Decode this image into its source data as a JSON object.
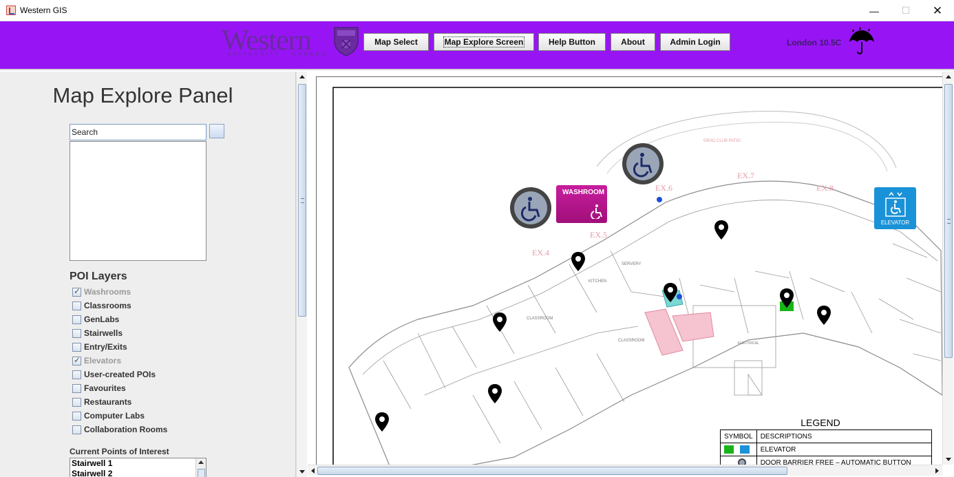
{
  "window": {
    "title": "Western GIS",
    "minimize_glyph": "—",
    "maximize_glyph": "☐",
    "close_glyph": "✕"
  },
  "header": {
    "logo_word": "Western",
    "logo_sub": "UNIVERSITY · CANADA",
    "nav": [
      {
        "label": "Map Select"
      },
      {
        "label": "Map Explore Screen"
      },
      {
        "label": "Help Button"
      },
      {
        "label": "About"
      },
      {
        "label": "Admin Login"
      }
    ],
    "weather_text": "London  10.5C",
    "weather_icon": "umbrella-icon",
    "accent_color": "#9715f4"
  },
  "left_panel": {
    "title": "Map Explore Panel",
    "search_value": "Search",
    "poi_heading": "POI Layers",
    "layers": [
      {
        "label": "Washrooms",
        "checked": true
      },
      {
        "label": "Classrooms",
        "checked": false
      },
      {
        "label": "GenLabs",
        "checked": false
      },
      {
        "label": "Stairwells",
        "checked": false
      },
      {
        "label": "Entry/Exits",
        "checked": false
      },
      {
        "label": "Elevators",
        "checked": true
      },
      {
        "label": "User-created POIs",
        "checked": false
      },
      {
        "label": "Favourites",
        "checked": false
      },
      {
        "label": "Restaurants",
        "checked": false
      },
      {
        "label": "Computer Labs",
        "checked": false
      },
      {
        "label": "Collaboration Rooms",
        "checked": false
      }
    ],
    "current_heading": "Current Points of Interest",
    "current_items": [
      "Stairwell 1",
      "Stairwell 2"
    ]
  },
  "map": {
    "labels": {
      "ex4": "EX.4",
      "ex5": "EX.5",
      "ex6": "EX.6",
      "ex7": "EX.7",
      "ex8": "EX.8",
      "patio": "GRAD CLUB PATIO",
      "classroom1": "CLASSROOM",
      "classroom2": "CLASSROOM",
      "servery": "SERVERY",
      "kitchen": "KITCHEN",
      "electrical": "ELECTRICAL"
    },
    "washroom_sign": "WASHROOM",
    "elevator_sign": "ELEVATOR",
    "legend": {
      "title": "LEGEND",
      "col_symbol": "SYMBOL",
      "col_desc": "DESCRIPTIONS",
      "rows": [
        "ELEVATOR",
        "DOOR BARRIER FREE – AUTOMATIC BUTTON"
      ]
    }
  }
}
